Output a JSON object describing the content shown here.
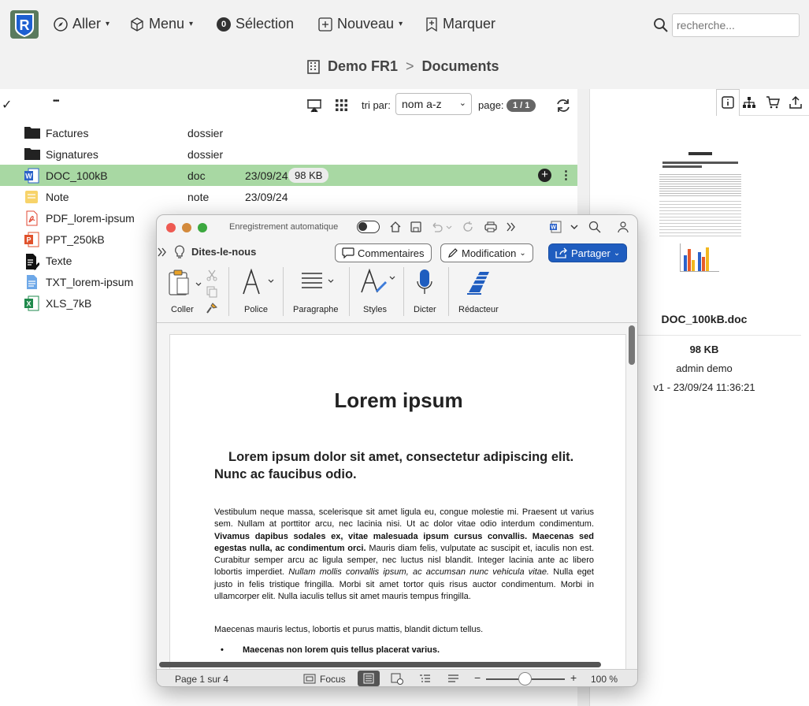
{
  "nav": {
    "go": "Aller",
    "menu": "Menu",
    "selection_count": "0",
    "selection": "Sélection",
    "new": "Nouveau",
    "mark": "Marquer"
  },
  "search": {
    "placeholder": "recherche..."
  },
  "breadcrumb": {
    "root": "Demo FR1",
    "separator": ">",
    "current": "Documents"
  },
  "list_toolbar": {
    "check": "✓",
    "more": "•••",
    "sort_label": "tri par:",
    "sort_value": "nom a-z",
    "page_label": "page:",
    "page_value": "1 / 1"
  },
  "files": [
    {
      "name": "Factures",
      "type": "dossier",
      "date": "",
      "size": "",
      "icon": "folder-icon"
    },
    {
      "name": "Signatures",
      "type": "dossier",
      "date": "",
      "size": "",
      "icon": "folder-icon"
    },
    {
      "name": "DOC_100kB",
      "type": "doc",
      "date": "23/09/24",
      "size": "98 KB",
      "icon": "word-icon"
    },
    {
      "name": "Note",
      "type": "note",
      "date": "23/09/24",
      "size": "",
      "icon": "note-icon"
    },
    {
      "name": "PDF_lorem-ipsum",
      "type": "",
      "date": "",
      "size": "",
      "icon": "pdf-icon"
    },
    {
      "name": "PPT_250kB",
      "type": "",
      "date": "",
      "size": "",
      "icon": "powerpoint-icon"
    },
    {
      "name": "Texte",
      "type": "",
      "date": "",
      "size": "",
      "icon": "text-doc-icon"
    },
    {
      "name": "TXT_lorem-ipsum",
      "type": "",
      "date": "",
      "size": "",
      "icon": "txt-icon"
    },
    {
      "name": "XLS_7kB",
      "type": "",
      "date": "",
      "size": "",
      "icon": "excel-icon"
    }
  ],
  "preview": {
    "filename": "DOC_100kB.doc",
    "size": "98 KB",
    "author": "admin demo",
    "version": "v1 - 23/09/24 11:36:21"
  },
  "word": {
    "autosave": "Enregistrement automatique",
    "tell_me": "Dites-le-nous",
    "comments": "Commentaires",
    "editing": "Modification",
    "share": "Partager",
    "ribbon": {
      "paste": "Coller",
      "font": "Police",
      "paragraph": "Paragraphe",
      "styles": "Styles",
      "dictate": "Dicter",
      "editor": "Rédacteur"
    },
    "doc": {
      "title": "Lorem ipsum",
      "subtitle": "Lorem ipsum dolor sit amet, consectetur adipiscing elit. Nunc ac faucibus odio.",
      "p1a": "Vestibulum neque massa, scelerisque sit amet ligula eu, congue molestie mi. Praesent ut varius sem. Nullam at porttitor arcu, nec lacinia nisi. Ut ac dolor vitae odio interdum condimentum. ",
      "p1b": "Vivamus dapibus sodales ex, vitae malesuada ipsum cursus convallis. Maecenas sed egestas nulla, ac condimentum orci.",
      "p1c": " Mauris diam felis, vulputate ac suscipit et, iaculis non est. Curabitur semper arcu ac ligula semper, nec luctus nisl blandit. Integer lacinia ante ac libero lobortis imperdiet. ",
      "p1d": "Nullam mollis convallis ipsum, ac accumsan nunc vehicula vitae.",
      "p1e": " Nulla eget justo in felis tristique fringilla. Morbi sit amet tortor quis risus auctor condimentum. Morbi in ullamcorper elit. Nulla iaculis tellus sit amet mauris tempus fringilla.",
      "p2": "Maecenas mauris lectus, lobortis et purus mattis, blandit dictum tellus.",
      "bullet1": "Maecenas non lorem quis tellus placerat varius."
    },
    "status": {
      "page": "Page 1 sur 4",
      "focus": "Focus",
      "zoom": "100 %"
    }
  },
  "colors": {
    "selected_row": "#a8d8a3",
    "share_button": "#1f5dbf"
  }
}
